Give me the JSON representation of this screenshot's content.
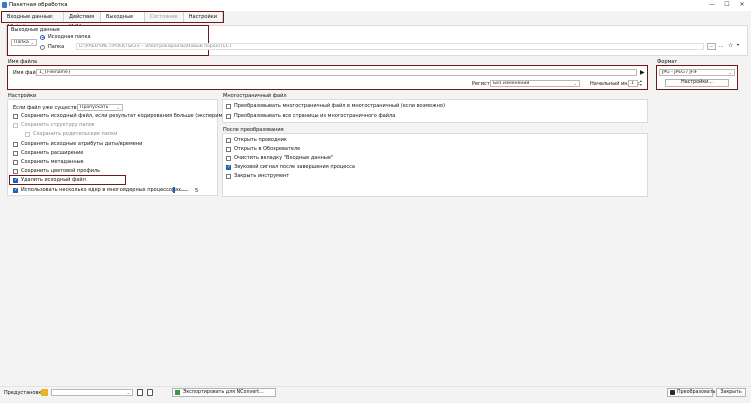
{
  "window": {
    "title": "Пакетная обработка",
    "controls": [
      "—",
      "☐",
      "✕"
    ]
  },
  "tabs": [
    {
      "label": "Входные данные: 12 файлов",
      "active": false,
      "disabled": false
    },
    {
      "label": "Действия [1/1]",
      "active": false,
      "disabled": false
    },
    {
      "label": "Выходные данные",
      "active": true,
      "disabled": false
    },
    {
      "label": "Состояние",
      "active": false,
      "disabled": true
    },
    {
      "label": "Настройки",
      "active": false,
      "disabled": false
    }
  ],
  "output": {
    "section_title": "Выходные данные",
    "mode_select": "Папка",
    "radio_source": "Исходная папка",
    "radio_folder": "Папка",
    "folder_path": "D:\\РАБОЧИЕ ПРОЕКТЫ\\ЗЗ – Электрокарнизы\\Новый порон\\ТЕСТ",
    "browse_label": "...",
    "more_label": "...",
    "star_label": "☆"
  },
  "filename": {
    "section_title": "Имя файла",
    "label": "Имя файла",
    "value": "1_{Filename}",
    "play_icon": "play-icon",
    "register_label": "Регистр",
    "register_value": "Без изменений",
    "start_index_label": "Начальный индекс",
    "start_index_value": "1"
  },
  "format": {
    "section_title": "Формат",
    "value": "JPG - JPEG / JFIF",
    "settings_button": "Настройки..."
  },
  "settings": {
    "section_title": "Настройки",
    "exists_label": "Если файл уже существует, то",
    "exists_value": "Пропускать",
    "options": [
      {
        "label": "Сохранить исходный файл, если результат кодирования больше (экспериментальный)",
        "checked": false,
        "disabled": false,
        "indent": 0
      },
      {
        "label": "Сохранить структуру папок",
        "checked": false,
        "disabled": true,
        "indent": 0
      },
      {
        "label": "Сохранить родительские папки",
        "checked": false,
        "disabled": true,
        "indent": 1
      },
      {
        "label": "Сохранять исходные атрибуты даты/времени",
        "checked": false,
        "disabled": false,
        "indent": 0
      },
      {
        "label": "Сохранить расширение",
        "checked": false,
        "disabled": false,
        "indent": 0
      },
      {
        "label": "Сохранить метаданные",
        "checked": false,
        "disabled": false,
        "indent": 0
      },
      {
        "label": "Сохранить цветовой профиль",
        "checked": false,
        "disabled": false,
        "indent": 0
      },
      {
        "label": "Удалить исходный файл",
        "checked": true,
        "disabled": false,
        "indent": 0
      },
      {
        "label": "Использовать несколько ядер в многоядерных процессорах",
        "checked": true,
        "disabled": false,
        "indent": 0
      }
    ],
    "cores_value": "5"
  },
  "multipage": {
    "section_title": "Многостраничный файл",
    "options": [
      {
        "label": "Преобразовывать многостраничный файл в многостраничный (если возможно)",
        "checked": false
      },
      {
        "label": "Преобразовывать все страницы из многостраничного файла",
        "checked": false
      }
    ]
  },
  "after": {
    "section_title": "После преобразования",
    "options": [
      {
        "label": "Открыть проводник",
        "checked": false
      },
      {
        "label": "Открыть в Обозревателе",
        "checked": false
      },
      {
        "label": "Очистить вкладку \"Входные данные\"",
        "checked": false
      },
      {
        "label": "Звуковой сигнал после завершения процесса",
        "checked": true
      },
      {
        "label": "Закрыть инструмент",
        "checked": false
      }
    ]
  },
  "footer": {
    "presets_label": "Предустановки:",
    "export_label": "Экспортировать для NConvert...",
    "convert_label": "Преобразовать",
    "close_label": "Закрыть"
  }
}
